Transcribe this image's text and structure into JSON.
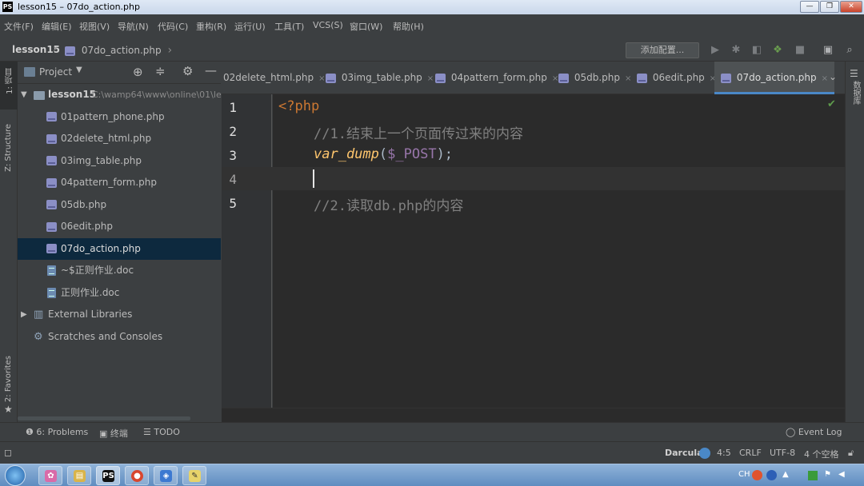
{
  "window": {
    "title": "lesson15 – 07do_action.php",
    "app_icon": "PS",
    "controls": {
      "minimize": "—",
      "maximize": "❐",
      "close": "✕"
    }
  },
  "menu": [
    "文件(F)",
    "编辑(E)",
    "视图(V)",
    "导航(N)",
    "代码(C)",
    "重构(R)",
    "运行(U)",
    "工具(T)",
    "VCS(S)",
    "窗口(W)",
    "帮助(H)"
  ],
  "breadcrumb": {
    "project": "lesson15",
    "file": "07do_action.php",
    "arrow": "›"
  },
  "toolbar": {
    "config_label": "添加配置..."
  },
  "left_stripe": {
    "project_tab": "1: 项目",
    "structure_tab": "Z: Structure",
    "favorites_tab": "2: Favorites"
  },
  "project_panel": {
    "title": "Project",
    "root_name": "lesson15",
    "root_path": "C:\\wamp64\\www\\online\\01\\le",
    "files": [
      {
        "name": "01pattern_phone.php",
        "type": "php"
      },
      {
        "name": "02delete_html.php",
        "type": "php"
      },
      {
        "name": "03img_table.php",
        "type": "php"
      },
      {
        "name": "04pattern_form.php",
        "type": "php"
      },
      {
        "name": "05db.php",
        "type": "php"
      },
      {
        "name": "06edit.php",
        "type": "php"
      },
      {
        "name": "07do_action.php",
        "type": "php",
        "selected": true
      },
      {
        "name": "~$正则作业.doc",
        "type": "doc"
      },
      {
        "name": "正则作业.doc",
        "type": "doc"
      }
    ],
    "external_libraries": "External Libraries",
    "scratches": "Scratches and Consoles"
  },
  "tabs": [
    {
      "label": "02delete_html.php",
      "close": "×"
    },
    {
      "label": "03img_table.php",
      "close": "×"
    },
    {
      "label": "04pattern_form.php",
      "close": "×"
    },
    {
      "label": "05db.php",
      "close": "×"
    },
    {
      "label": "06edit.php",
      "close": "×"
    },
    {
      "label": "07do_action.php",
      "close": "×",
      "active": true
    }
  ],
  "editor": {
    "line_numbers": [
      "1",
      "2",
      "3",
      "4",
      "5"
    ],
    "lines": {
      "l1": "<?php",
      "l2": "//1.结束上一个页面传过来的内容",
      "l3_fn": "var_dump",
      "l3_open": "(",
      "l3_var": "$_POST",
      "l3_close": ");",
      "l5": "//2.读取db.php的内容"
    },
    "caret_line": 4,
    "inspection_icon": "✔"
  },
  "right_stripe": {
    "database_tab": "数据库"
  },
  "bottom_tools": {
    "problems": "6: Problems",
    "terminal": "终端",
    "todo": "TODO",
    "event_log": "Event Log"
  },
  "status": {
    "theme": "Darcula",
    "position": "4:5",
    "line_sep": "CRLF",
    "encoding": "UTF-8",
    "indent": "4 个空格"
  },
  "taskbar": {
    "apps": [
      "start-orb",
      "app-pink",
      "explorer",
      "phpstorm",
      "chrome",
      "app-blue",
      "app-notes"
    ],
    "tray_text": "CH"
  },
  "colors": {
    "editor_bg": "#2b2b2b",
    "keyword": "#cc7832",
    "comment": "#808080",
    "function": "#ffc66d",
    "variable": "#9876aa",
    "selection": "#0d293e"
  }
}
